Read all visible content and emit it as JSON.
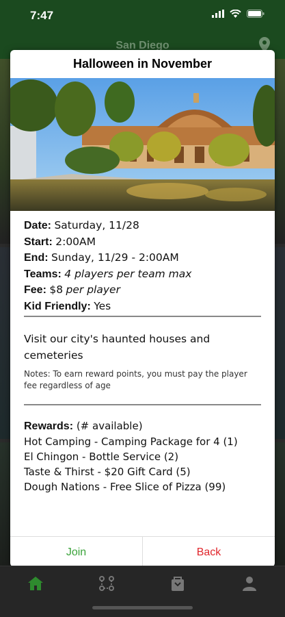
{
  "status_bar": {
    "time": "7:47"
  },
  "app_header": {
    "city": "San Diego"
  },
  "modal": {
    "title": "Halloween in November",
    "details": [
      {
        "label": "Date:",
        "value": "Saturday, 11/28"
      },
      {
        "label": "Start:",
        "value": "2:00AM"
      },
      {
        "label": "End:",
        "value": "Sunday, 11/29 - 2:00AM"
      },
      {
        "label": "Teams:",
        "value": "4 players per team max"
      },
      {
        "label": "Fee:",
        "value": "$8",
        "value_suffix": "per player"
      },
      {
        "label": "Kid Friendly:",
        "value": "Yes"
      }
    ],
    "description": "Visit our city's haunted houses and cemeteries",
    "notes": "Notes: To earn reward points, you must pay the player fee regardless of age",
    "rewards": {
      "label": "Rewards:",
      "subtitle": "(# available)",
      "items": [
        "Hot Camping - Camping Package for 4 (1)",
        "El Chingon - Bottle Service (2)",
        "Taste & Thirst - $20 Gift Card (5)",
        "Dough Nations - Free Slice of Pizza (99)"
      ]
    },
    "buttons": {
      "join": "Join",
      "back": "Back"
    }
  },
  "tabbar": {
    "items": [
      {
        "icon": "home-icon",
        "active": true
      },
      {
        "icon": "route-icon",
        "active": false
      },
      {
        "icon": "bag-icon",
        "active": false
      },
      {
        "icon": "profile-icon",
        "active": false
      }
    ]
  },
  "colors": {
    "header_green": "#1b4a1f",
    "join_green": "#3aa33a",
    "back_red": "#e0252b",
    "active_tab": "#2e8a2e"
  }
}
